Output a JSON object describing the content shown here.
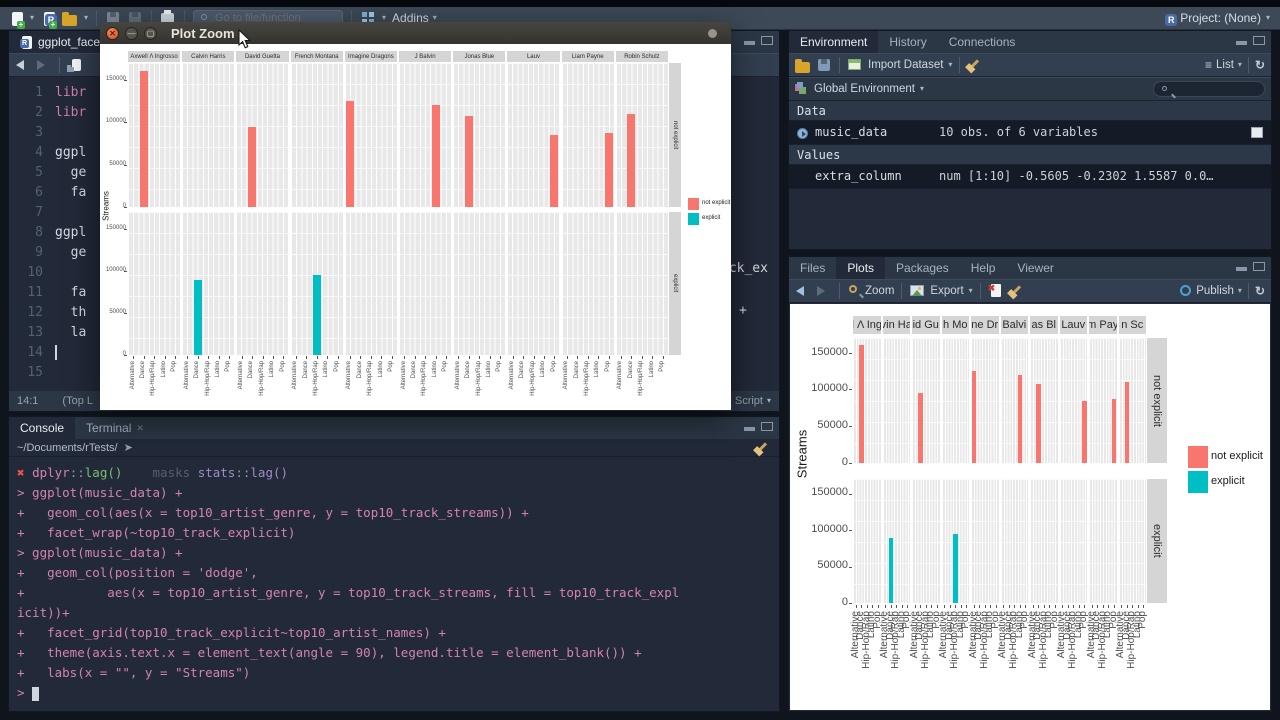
{
  "toolbar": {
    "goto_placeholder": "Go to file/function",
    "addins_label": "Addins",
    "project_label": "Project: (None)"
  },
  "plot_zoom_window": {
    "title": "Plot Zoom"
  },
  "source_editor": {
    "tab_label": "ggplot_face",
    "status_position": "14:1",
    "status_scope": "(Top L",
    "status_type": "Script",
    "fragment_wrap": "ack_ex",
    "fragment_plus": "+",
    "lines": [
      {
        "n": "1",
        "t": "libr",
        "c": "keyword"
      },
      {
        "n": "2",
        "t": "libr",
        "c": "keyword"
      },
      {
        "n": "3",
        "t": "",
        "c": "plain"
      },
      {
        "n": "4",
        "t": "ggpl",
        "c": "plain"
      },
      {
        "n": "5",
        "t": "  ge",
        "c": "plain"
      },
      {
        "n": "6",
        "t": "  fa",
        "c": "plain"
      },
      {
        "n": "7",
        "t": "",
        "c": "plain"
      },
      {
        "n": "8",
        "t": "ggpl",
        "c": "plain"
      },
      {
        "n": "9",
        "t": "  ge",
        "c": "plain"
      },
      {
        "n": "10",
        "t": "",
        "c": "plain"
      },
      {
        "n": "11",
        "t": "  fa",
        "c": "plain"
      },
      {
        "n": "12",
        "t": "  th",
        "c": "plain"
      },
      {
        "n": "13",
        "t": "  la",
        "c": "plain"
      },
      {
        "n": "14",
        "t": "",
        "c": "plain"
      },
      {
        "n": "15",
        "t": "",
        "c": "plain"
      }
    ]
  },
  "console": {
    "tab_console": "Console",
    "tab_terminal": "Terminal",
    "cwd": "~/Documents/rTests/",
    "lines": [
      [
        {
          "t": "✖ ",
          "c": "err"
        },
        {
          "t": "dplyr",
          "c": "code"
        },
        {
          "t": "::",
          "c": "muted"
        },
        {
          "t": "lag()",
          "c": "green"
        },
        {
          "t": "    ",
          "c": "plain"
        },
        {
          "t": "masks",
          "c": "dim"
        },
        {
          "t": " ",
          "c": "plain"
        },
        {
          "t": "stats",
          "c": "purple"
        },
        {
          "t": "::",
          "c": "muted"
        },
        {
          "t": "lag()",
          "c": "purple"
        }
      ],
      [
        {
          "t": "> ggplot(music_data) +",
          "c": "code"
        }
      ],
      [
        {
          "t": "+   geom_col(aes(x = top10_artist_genre, y = top10_track_streams)) +",
          "c": "code"
        }
      ],
      [
        {
          "t": "+   facet_wrap(~top10_track_explicit)",
          "c": "code"
        }
      ],
      [
        {
          "t": "> ggplot(music_data) +",
          "c": "code"
        }
      ],
      [
        {
          "t": "+   geom_col(position = 'dodge',",
          "c": "code"
        }
      ],
      [
        {
          "t": "+           aes(x = top10_artist_genre, y = top10_track_streams, fill = top10_track_expl",
          "c": "code"
        }
      ],
      [
        {
          "t": "icit))+",
          "c": "code"
        }
      ],
      [
        {
          "t": "+   facet_grid(top10_track_explicit~top10_artist_names) +",
          "c": "code"
        }
      ],
      [
        {
          "t": "+   theme(axis.text.x = element_text(angle = 90), legend.title = element_blank()) +",
          "c": "code"
        }
      ],
      [
        {
          "t": "+   labs(x = \"\", y = \"Streams\")",
          "c": "code"
        }
      ],
      [
        {
          "t": "> ",
          "c": "code"
        }
      ]
    ]
  },
  "environment": {
    "tabs": [
      "Environment",
      "History",
      "Connections"
    ],
    "import_dataset_label": "Import Dataset",
    "list_label": "List",
    "global_env_label": "Global Environment",
    "section_data": "Data",
    "section_values": "Values",
    "rows": [
      {
        "name": "music_data",
        "value": "10 obs. of 6 variables"
      },
      {
        "name": "extra_column",
        "value": "num [1:10] -0.5605 -0.2302 1.5587 0.0…"
      }
    ]
  },
  "plots_panel": {
    "tabs": [
      "Files",
      "Plots",
      "Packages",
      "Help",
      "Viewer"
    ],
    "zoom_label": "Zoom",
    "export_label": "Export",
    "publish_label": "Publish"
  },
  "chart_data": {
    "type": "bar",
    "title": "",
    "xlabel": "",
    "ylabel": "Streams",
    "facet_col_label_full": [
      "Axwell Λ Ingrosso",
      "Calvin Harris",
      "David Guetta",
      "French Montana",
      "Imagine Dragons",
      "J Balvin",
      "Jonas Blue",
      "Lauv",
      "Liam Payne",
      "Robin Schulz"
    ],
    "facet_col_label_truncated": [
      "l Λ Ing",
      "vin Ha",
      "id Gu",
      "h Mo",
      "ne Dr",
      "Balvi",
      "as Bl",
      "Lauv",
      "m Pay",
      "n Sc"
    ],
    "facet_rows": [
      "not explicit",
      "explicit"
    ],
    "categories": [
      "Alternative",
      "Dance",
      "Hip-Hop/Rap",
      "Latino",
      "Pop"
    ],
    "y_ticks": [
      0,
      50000,
      100000,
      150000
    ],
    "ylim": [
      0,
      170000
    ],
    "grid": true,
    "legend_position": "right",
    "legend": [
      {
        "label": "not explicit",
        "color": "#f8766d"
      },
      {
        "label": "explicit",
        "color": "#00bfc4"
      }
    ],
    "bars": [
      {
        "artist": "Axwell Λ Ingrosso",
        "artist_index": 0,
        "genre": "Dance",
        "row": "not explicit",
        "streams": 160000
      },
      {
        "artist": "David Guetta",
        "artist_index": 2,
        "genre": "Dance",
        "row": "not explicit",
        "streams": 95000
      },
      {
        "artist": "Imagine Dragons",
        "artist_index": 4,
        "genre": "Alternative",
        "row": "not explicit",
        "streams": 125000
      },
      {
        "artist": "J Balvin",
        "artist_index": 5,
        "genre": "Latino",
        "row": "not explicit",
        "streams": 120000
      },
      {
        "artist": "Jonas Blue",
        "artist_index": 6,
        "genre": "Dance",
        "row": "not explicit",
        "streams": 108000
      },
      {
        "artist": "Lauv",
        "artist_index": 7,
        "genre": "Pop",
        "row": "not explicit",
        "streams": 85000
      },
      {
        "artist": "Liam Payne",
        "artist_index": 8,
        "genre": "Pop",
        "row": "not explicit",
        "streams": 87000
      },
      {
        "artist": "Robin Schulz",
        "artist_index": 9,
        "genre": "Dance",
        "row": "not explicit",
        "streams": 110000
      },
      {
        "artist": "Calvin Harris",
        "artist_index": 1,
        "genre": "Dance",
        "row": "explicit",
        "streams": 89000
      },
      {
        "artist": "French Montana",
        "artist_index": 3,
        "genre": "Hip-Hop/Rap",
        "row": "explicit",
        "streams": 95000
      }
    ]
  }
}
